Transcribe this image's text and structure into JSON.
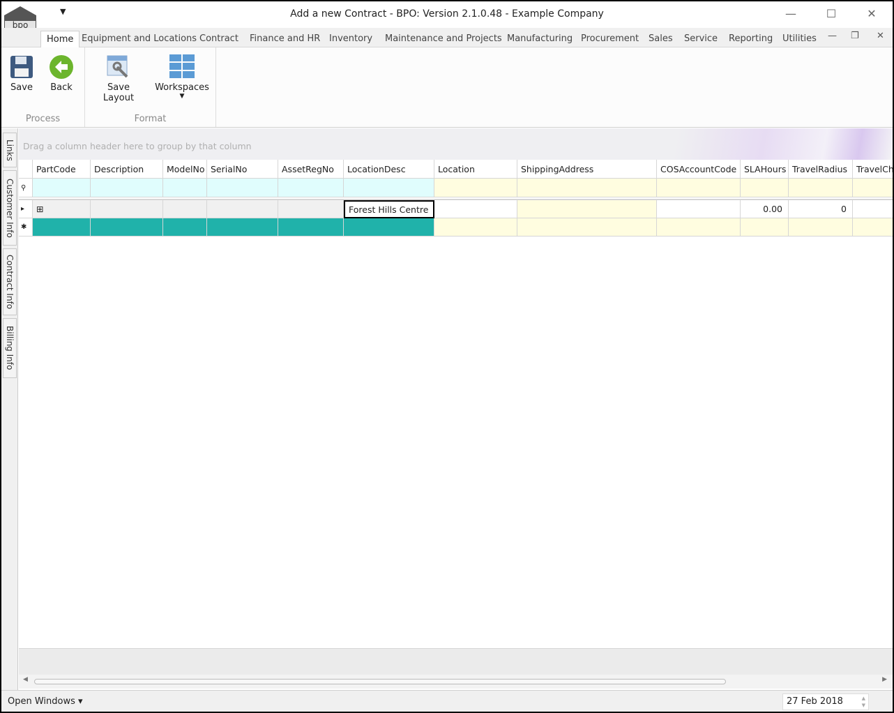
{
  "window": {
    "title": "Add a new Contract - BPO: Version 2.1.0.48 - Example Company",
    "logo_text": "bpo"
  },
  "tabs": [
    "Home",
    "Equipment and Locations",
    "Contract",
    "Finance and HR",
    "Inventory",
    "Maintenance and Projects",
    "Manufacturing",
    "Procurement",
    "Sales",
    "Service",
    "Reporting",
    "Utilities"
  ],
  "ribbon": {
    "process": {
      "label": "Process",
      "save": "Save",
      "back": "Back"
    },
    "format": {
      "label": "Format",
      "save_layout": "Save Layout",
      "workspaces": "Workspaces"
    }
  },
  "side_tabs": [
    "Links",
    "Customer Info",
    "Contract Info",
    "Billing Info"
  ],
  "grid": {
    "group_hint": "Drag a column header here to group by that column",
    "columns": [
      "PartCode",
      "Description",
      "ModelNo",
      "SerialNo",
      "AssetRegNo",
      "LocationDesc",
      "Location",
      "ShippingAddress",
      "COSAccountCode",
      "SLAHours",
      "TravelRadius",
      "TravelCh"
    ],
    "row": [
      "",
      "",
      "",
      "",
      "",
      "Forest Hills Centre",
      "",
      "",
      "",
      "0.00",
      "0",
      ""
    ]
  },
  "status": {
    "open_windows": "Open Windows",
    "date": "27 Feb 2018"
  },
  "colors": {
    "new_row": "#20b2aa",
    "filter_row": "#e0fdfd",
    "editable": "#fffde0"
  }
}
